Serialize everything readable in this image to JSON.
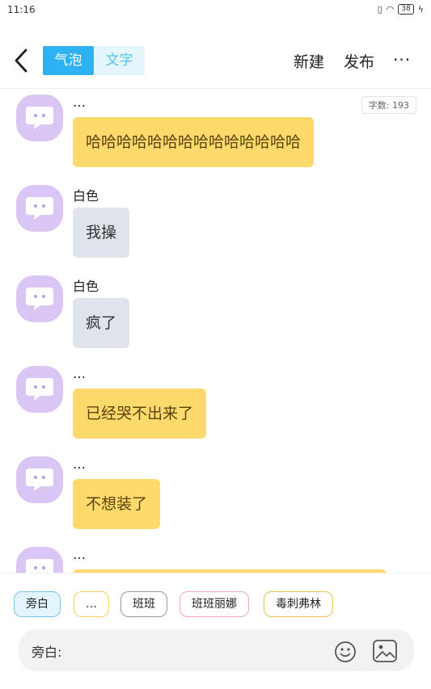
{
  "status_bar": {
    "time": "11:16",
    "battery": "38",
    "icons": [
      "vibrate-icon",
      "wifi-icon",
      "battery-icon",
      "charging-icon"
    ]
  },
  "nav": {
    "tabs": [
      {
        "label": "气泡",
        "active": true
      },
      {
        "label": "文字",
        "active": false
      }
    ],
    "new_label": "新建",
    "publish_label": "发布",
    "more_label": "···"
  },
  "word_count": "字数: 193",
  "messages": [
    {
      "name": "…",
      "text": "哈哈哈哈哈哈哈哈哈哈哈哈哈哈",
      "color": "yellow"
    },
    {
      "name": "白色",
      "text": "我操",
      "color": "gray"
    },
    {
      "name": "白色",
      "text": "疯了",
      "color": "gray"
    },
    {
      "name": "…",
      "text": "已经哭不出来了",
      "color": "yellow"
    },
    {
      "name": "…",
      "text": "不想装了",
      "color": "yellow"
    },
    {
      "name": "…",
      "text": "",
      "color": "yellow"
    }
  ],
  "roles": [
    "旁白",
    "…",
    "班班",
    "班班丽娜",
    "毒刺弗林"
  ],
  "input": {
    "label": "旁白:"
  },
  "colors": {
    "accent": "#2fb2f4",
    "bubble_yellow": "#fdda6b",
    "bubble_gray": "#dfe4ec",
    "avatar": "#d9c6f4"
  }
}
